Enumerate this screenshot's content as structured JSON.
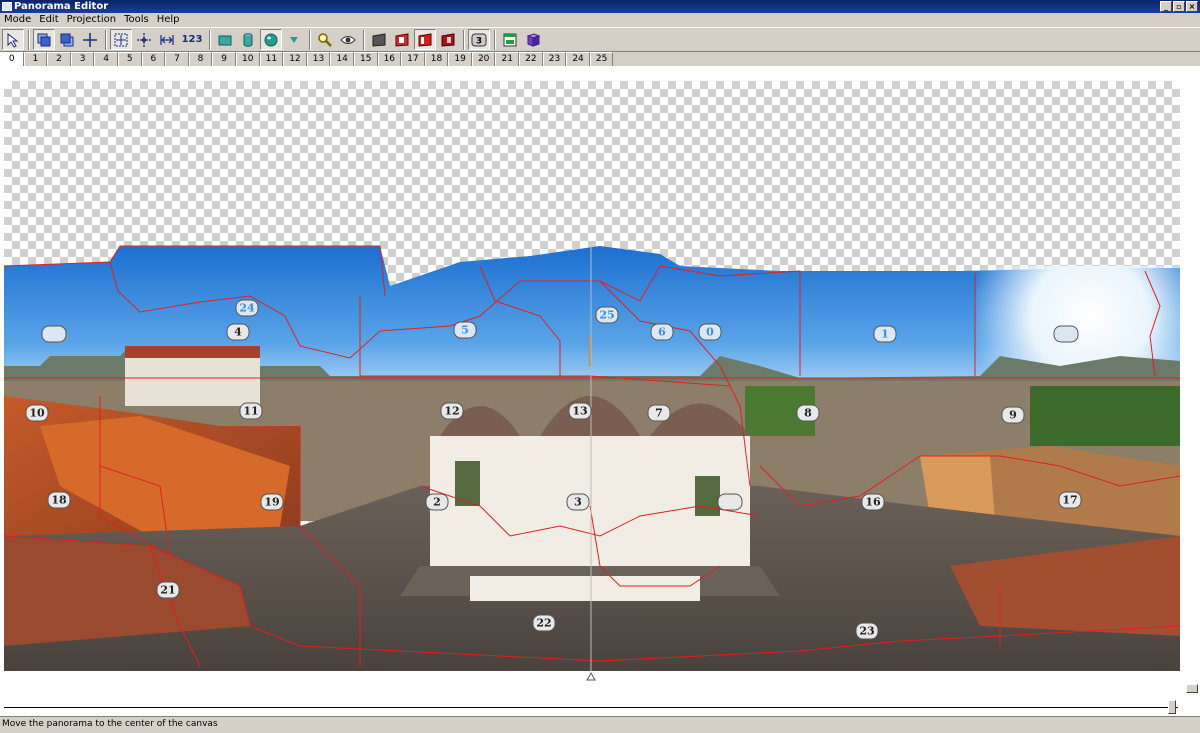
{
  "window": {
    "title": "Panorama Editor"
  },
  "menu": [
    "Mode",
    "Edit",
    "Projection",
    "Tools",
    "Help"
  ],
  "toolbar": {
    "number_label": "123",
    "badge": "3",
    "icons": [
      "select-arrow-icon",
      "layers-front-icon",
      "layers-back-icon",
      "crosshair-icon",
      "fit-canvas-icon",
      "move-center-icon",
      "stretch-horizontal-icon",
      "number-labels",
      "plane-projection-icon",
      "cylinder-projection-icon",
      "sphere-projection-icon",
      "dropdown-triangle-icon",
      "zoom-icon",
      "eye-icon",
      "frame-gray-icon",
      "frame-red-icon",
      "frame-red-selected-icon",
      "frame-red-dark-icon",
      "badge-icon",
      "window-green-icon",
      "book-icon"
    ]
  },
  "tabs": [
    "0",
    "1",
    "2",
    "3",
    "4",
    "5",
    "6",
    "7",
    "8",
    "9",
    "10",
    "11",
    "12",
    "13",
    "14",
    "15",
    "16",
    "17",
    "18",
    "19",
    "20",
    "21",
    "22",
    "23",
    "24",
    "25"
  ],
  "active_tab": "0",
  "labels": [
    {
      "text": "24",
      "sky": true
    },
    {
      "text": "4",
      "sky": false
    },
    {
      "text": "5",
      "sky": true
    },
    {
      "text": "25",
      "sky": true
    },
    {
      "text": "6",
      "sky": true
    },
    {
      "text": "0",
      "sky": true
    },
    {
      "text": "1",
      "sky": true
    },
    {
      "text": "10",
      "sky": false
    },
    {
      "text": "11",
      "sky": false
    },
    {
      "text": "12",
      "sky": false
    },
    {
      "text": "13",
      "sky": false
    },
    {
      "text": "7",
      "sky": false
    },
    {
      "text": "8",
      "sky": false
    },
    {
      "text": "9",
      "sky": false
    },
    {
      "text": "18",
      "sky": false
    },
    {
      "text": "19",
      "sky": false
    },
    {
      "text": "2",
      "sky": false
    },
    {
      "text": "3",
      "sky": false
    },
    {
      "text": "16",
      "sky": false
    },
    {
      "text": "17",
      "sky": false
    },
    {
      "text": "21",
      "sky": false
    },
    {
      "text": "22",
      "sky": false
    },
    {
      "text": "23",
      "sky": false
    }
  ],
  "status": "Move the panorama to the center of the canvas"
}
